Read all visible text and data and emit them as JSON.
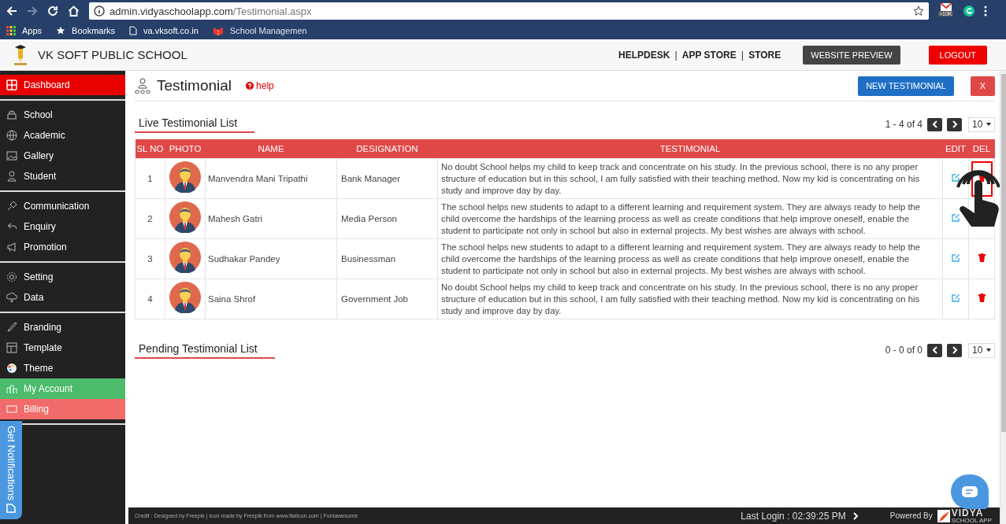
{
  "browser": {
    "url_host": "admin.vidyaschoolapp.com",
    "url_path": "/Testimonial.aspx",
    "extension_badge": ">10K",
    "bookmarks": [
      "Apps",
      "Bookmarks",
      "va.vksoft.co.in",
      "School Managemen"
    ]
  },
  "header": {
    "school_name": "VK SOFT PUBLIC SCHOOL",
    "links": [
      "HELPDESK",
      "APP STORE",
      "STORE"
    ],
    "separator": "|",
    "buttons": [
      {
        "label": "WEBSITE PREVIEW",
        "kind": "dark"
      },
      {
        "label": "LOGOUT",
        "kind": "danger"
      }
    ]
  },
  "sidebar": {
    "groups": [
      [
        {
          "label": "Dashboard",
          "selected": true
        }
      ],
      [
        {
          "label": "School",
          "selected": false
        },
        {
          "label": "Academic",
          "selected": false
        },
        {
          "label": "Gallery",
          "selected": false
        },
        {
          "label": "Student",
          "selected": false
        }
      ],
      [
        {
          "label": "Communication",
          "selected": false
        },
        {
          "label": "Enquiry",
          "selected": false
        },
        {
          "label": "Promotion",
          "selected": false
        }
      ],
      [
        {
          "label": "Setting",
          "selected": false
        },
        {
          "label": "Data",
          "selected": false
        }
      ],
      [
        {
          "label": "Branding",
          "selected": false
        },
        {
          "label": "Template",
          "selected": false
        },
        {
          "label": "Theme",
          "selected": false
        },
        {
          "label": "My Account",
          "selected": false,
          "color": "#4cbb6c"
        },
        {
          "label": "Billing",
          "selected": false,
          "color": "#f26b6b"
        }
      ]
    ]
  },
  "notifications_tab": {
    "label": "Get Notifications"
  },
  "page": {
    "title": "Testimonial",
    "help": "help",
    "new_button": "NEW TESTIMONIAL",
    "close_button": "X"
  },
  "live_list": {
    "title": "Live Testimonial List",
    "range": "1 - 4 of 4",
    "page_size": "10",
    "columns": [
      "SL NO",
      "PHOTO",
      "NAME",
      "DESIGNATION",
      "TESTIMONIAL",
      "EDIT",
      "DEL"
    ],
    "rows": [
      {
        "sl": "1",
        "name": "Manvendra Mani Tripathi",
        "designation": "Bank Manager",
        "testimonial": "No doubt School helps my child to keep track and concentrate on his study. In the previous school, there is no any proper structure of education but in this school, I am fully satisfied with their teaching method. Now my kid is concentrating on his study and improve day by day.",
        "highlighted": true
      },
      {
        "sl": "2",
        "name": "Mahesh Gatri",
        "designation": "Media Person",
        "testimonial": "The school helps new students to adapt to a different learning and requirement system. They are always ready to help the child overcome the hardships of the learning process as well as create conditions that help improve oneself, enable the student to participate not only in school but also in external projects. My best wishes are always with school.",
        "highlighted": false
      },
      {
        "sl": "3",
        "name": "Sudhakar Pandey",
        "designation": "Businessman",
        "testimonial": "The school helps new students to adapt to a different learning and requirement system. They are always ready to help the child overcome the hardships of the learning process as well as create conditions that help improve oneself, enable the student to participate not only in school but also in external projects. My best wishes are always with school.",
        "highlighted": false
      },
      {
        "sl": "4",
        "name": "Saina Shrof",
        "designation": "Government Job",
        "testimonial": "No doubt School helps my child to keep track and concentrate on his study. In the previous school, there is no any proper structure of education but in this school, I am fully satisfied with their teaching method. Now my kid is concentrating on his study and improve day by day.",
        "highlighted": false
      }
    ]
  },
  "pending_list": {
    "title": "Pending Testimonial List",
    "range": "0 - 0 of 0",
    "page_size": "10"
  },
  "footer": {
    "credit": "Credit : Designed by Freepik | Icon made by Freepik from www.flaticon.com | Fontawesome",
    "last_login": "Last Login : 02:39:25 PM",
    "powered_by": "Powered By",
    "brand": "VIDYA",
    "brand_sub": "SCHOOL APP"
  }
}
